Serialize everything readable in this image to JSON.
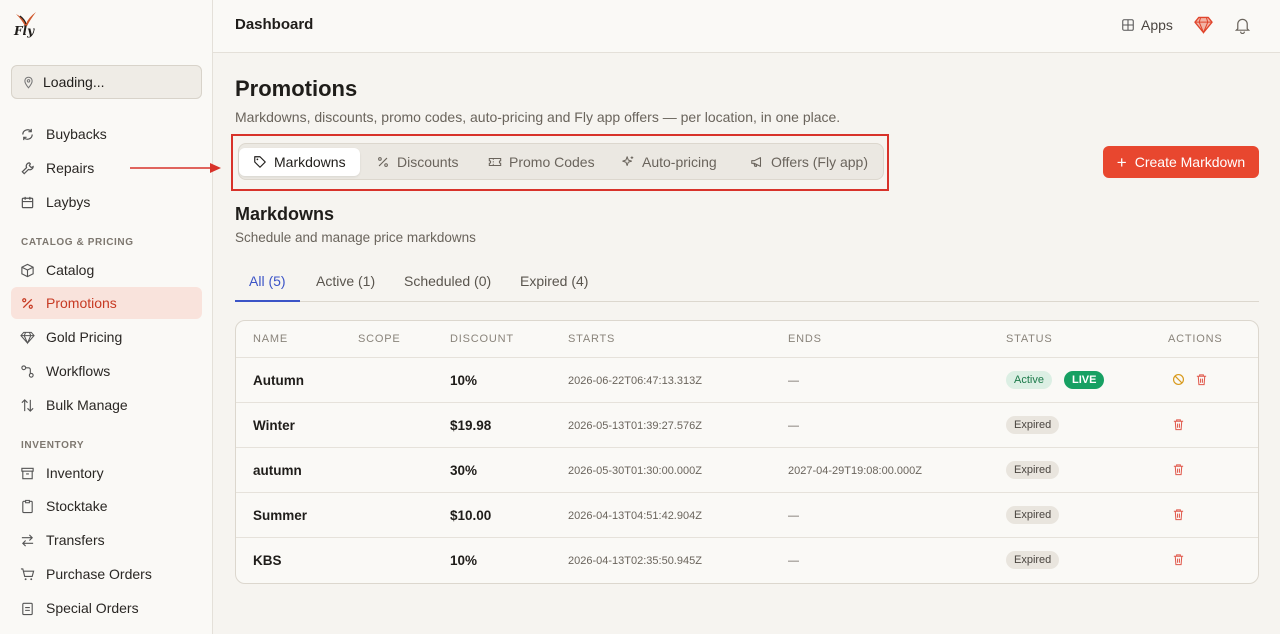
{
  "brand": {
    "logo_text": "Fly"
  },
  "location": {
    "label": "Loading..."
  },
  "sidebar": {
    "top_items": [
      {
        "label": "Buybacks",
        "icon": "buyback-icon"
      },
      {
        "label": "Repairs",
        "icon": "wrench-icon"
      },
      {
        "label": "Laybys",
        "icon": "calendar-icon"
      }
    ],
    "section_catalog": "CATALOG & PRICING",
    "catalog_items": [
      {
        "label": "Catalog",
        "icon": "box-icon"
      },
      {
        "label": "Promotions",
        "icon": "percent-icon",
        "active": true
      },
      {
        "label": "Gold Pricing",
        "icon": "gem-icon"
      },
      {
        "label": "Workflows",
        "icon": "workflow-icon"
      },
      {
        "label": "Bulk Manage",
        "icon": "sort-icon"
      }
    ],
    "section_inventory": "INVENTORY",
    "inventory_items": [
      {
        "label": "Inventory",
        "icon": "archive-icon"
      },
      {
        "label": "Stocktake",
        "icon": "clipboard-icon"
      },
      {
        "label": "Transfers",
        "icon": "transfer-icon"
      },
      {
        "label": "Purchase Orders",
        "icon": "cart-icon"
      },
      {
        "label": "Special Orders",
        "icon": "clipboard-list-icon"
      }
    ]
  },
  "topbar": {
    "title": "Dashboard",
    "apps_label": "Apps"
  },
  "page": {
    "title": "Promotions",
    "subtitle": "Markdowns, discounts, promo codes, auto-pricing and Fly app offers — per location, in one place."
  },
  "tabs": [
    {
      "label": "Markdowns",
      "icon": "tag-icon",
      "active": true
    },
    {
      "label": "Discounts",
      "icon": "percent-icon"
    },
    {
      "label": "Promo Codes",
      "icon": "ticket-icon"
    },
    {
      "label": "Auto-pricing",
      "icon": "sparkles-icon"
    },
    {
      "label": "Offers (Fly app)",
      "icon": "megaphone-icon"
    }
  ],
  "create_button": {
    "label": "Create Markdown"
  },
  "section": {
    "title": "Markdowns",
    "subtitle": "Schedule and manage price markdowns"
  },
  "subtabs": [
    {
      "label": "All (5)",
      "active": true
    },
    {
      "label": "Active (1)"
    },
    {
      "label": "Scheduled (0)"
    },
    {
      "label": "Expired (4)"
    }
  ],
  "table": {
    "headers": [
      "NAME",
      "SCOPE",
      "DISCOUNT",
      "STARTS",
      "ENDS",
      "STATUS",
      "ACTIONS"
    ],
    "rows": [
      {
        "name": "Autumn",
        "scope": "",
        "discount": "10%",
        "starts": "2026-06-22T06:47:13.313Z",
        "ends": "—",
        "status": "Active",
        "live": "LIVE"
      },
      {
        "name": "Winter",
        "scope": "",
        "discount": "$19.98",
        "starts": "2026-05-13T01:39:27.576Z",
        "ends": "—",
        "status": "Expired"
      },
      {
        "name": "autumn",
        "scope": "",
        "discount": "30%",
        "starts": "2026-05-30T01:30:00.000Z",
        "ends": "2027-04-29T19:08:00.000Z",
        "status": "Expired"
      },
      {
        "name": "Summer",
        "scope": "",
        "discount": "$10.00",
        "starts": "2026-04-13T04:51:42.904Z",
        "ends": "—",
        "status": "Expired"
      },
      {
        "name": "KBS",
        "scope": "",
        "discount": "10%",
        "starts": "2026-04-13T02:35:50.945Z",
        "ends": "—",
        "status": "Expired"
      }
    ]
  },
  "colors": {
    "accent": "#e8472f",
    "active_tab": "#3c54c7",
    "live": "#17a063",
    "highlight": "#d8322a"
  }
}
